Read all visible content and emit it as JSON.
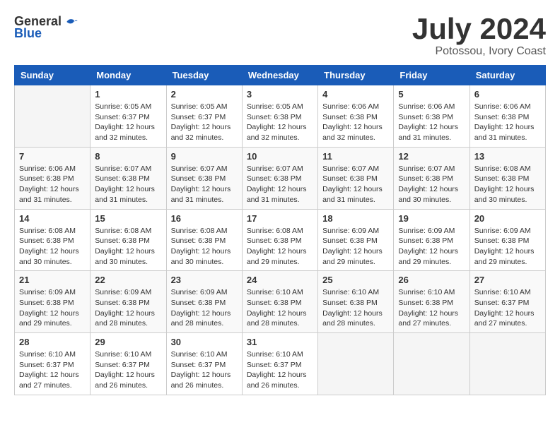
{
  "logo": {
    "general": "General",
    "blue": "Blue"
  },
  "title": {
    "month_year": "July 2024",
    "location": "Potossou, Ivory Coast"
  },
  "days_of_week": [
    "Sunday",
    "Monday",
    "Tuesday",
    "Wednesday",
    "Thursday",
    "Friday",
    "Saturday"
  ],
  "weeks": [
    [
      {
        "day": "",
        "info": ""
      },
      {
        "day": "1",
        "info": "Sunrise: 6:05 AM\nSunset: 6:37 PM\nDaylight: 12 hours\nand 32 minutes."
      },
      {
        "day": "2",
        "info": "Sunrise: 6:05 AM\nSunset: 6:37 PM\nDaylight: 12 hours\nand 32 minutes."
      },
      {
        "day": "3",
        "info": "Sunrise: 6:05 AM\nSunset: 6:38 PM\nDaylight: 12 hours\nand 32 minutes."
      },
      {
        "day": "4",
        "info": "Sunrise: 6:06 AM\nSunset: 6:38 PM\nDaylight: 12 hours\nand 32 minutes."
      },
      {
        "day": "5",
        "info": "Sunrise: 6:06 AM\nSunset: 6:38 PM\nDaylight: 12 hours\nand 31 minutes."
      },
      {
        "day": "6",
        "info": "Sunrise: 6:06 AM\nSunset: 6:38 PM\nDaylight: 12 hours\nand 31 minutes."
      }
    ],
    [
      {
        "day": "7",
        "info": "Sunrise: 6:06 AM\nSunset: 6:38 PM\nDaylight: 12 hours\nand 31 minutes."
      },
      {
        "day": "8",
        "info": "Sunrise: 6:07 AM\nSunset: 6:38 PM\nDaylight: 12 hours\nand 31 minutes."
      },
      {
        "day": "9",
        "info": "Sunrise: 6:07 AM\nSunset: 6:38 PM\nDaylight: 12 hours\nand 31 minutes."
      },
      {
        "day": "10",
        "info": "Sunrise: 6:07 AM\nSunset: 6:38 PM\nDaylight: 12 hours\nand 31 minutes."
      },
      {
        "day": "11",
        "info": "Sunrise: 6:07 AM\nSunset: 6:38 PM\nDaylight: 12 hours\nand 31 minutes."
      },
      {
        "day": "12",
        "info": "Sunrise: 6:07 AM\nSunset: 6:38 PM\nDaylight: 12 hours\nand 30 minutes."
      },
      {
        "day": "13",
        "info": "Sunrise: 6:08 AM\nSunset: 6:38 PM\nDaylight: 12 hours\nand 30 minutes."
      }
    ],
    [
      {
        "day": "14",
        "info": "Sunrise: 6:08 AM\nSunset: 6:38 PM\nDaylight: 12 hours\nand 30 minutes."
      },
      {
        "day": "15",
        "info": "Sunrise: 6:08 AM\nSunset: 6:38 PM\nDaylight: 12 hours\nand 30 minutes."
      },
      {
        "day": "16",
        "info": "Sunrise: 6:08 AM\nSunset: 6:38 PM\nDaylight: 12 hours\nand 30 minutes."
      },
      {
        "day": "17",
        "info": "Sunrise: 6:08 AM\nSunset: 6:38 PM\nDaylight: 12 hours\nand 29 minutes."
      },
      {
        "day": "18",
        "info": "Sunrise: 6:09 AM\nSunset: 6:38 PM\nDaylight: 12 hours\nand 29 minutes."
      },
      {
        "day": "19",
        "info": "Sunrise: 6:09 AM\nSunset: 6:38 PM\nDaylight: 12 hours\nand 29 minutes."
      },
      {
        "day": "20",
        "info": "Sunrise: 6:09 AM\nSunset: 6:38 PM\nDaylight: 12 hours\nand 29 minutes."
      }
    ],
    [
      {
        "day": "21",
        "info": "Sunrise: 6:09 AM\nSunset: 6:38 PM\nDaylight: 12 hours\nand 29 minutes."
      },
      {
        "day": "22",
        "info": "Sunrise: 6:09 AM\nSunset: 6:38 PM\nDaylight: 12 hours\nand 28 minutes."
      },
      {
        "day": "23",
        "info": "Sunrise: 6:09 AM\nSunset: 6:38 PM\nDaylight: 12 hours\nand 28 minutes."
      },
      {
        "day": "24",
        "info": "Sunrise: 6:10 AM\nSunset: 6:38 PM\nDaylight: 12 hours\nand 28 minutes."
      },
      {
        "day": "25",
        "info": "Sunrise: 6:10 AM\nSunset: 6:38 PM\nDaylight: 12 hours\nand 28 minutes."
      },
      {
        "day": "26",
        "info": "Sunrise: 6:10 AM\nSunset: 6:38 PM\nDaylight: 12 hours\nand 27 minutes."
      },
      {
        "day": "27",
        "info": "Sunrise: 6:10 AM\nSunset: 6:37 PM\nDaylight: 12 hours\nand 27 minutes."
      }
    ],
    [
      {
        "day": "28",
        "info": "Sunrise: 6:10 AM\nSunset: 6:37 PM\nDaylight: 12 hours\nand 27 minutes."
      },
      {
        "day": "29",
        "info": "Sunrise: 6:10 AM\nSunset: 6:37 PM\nDaylight: 12 hours\nand 26 minutes."
      },
      {
        "day": "30",
        "info": "Sunrise: 6:10 AM\nSunset: 6:37 PM\nDaylight: 12 hours\nand 26 minutes."
      },
      {
        "day": "31",
        "info": "Sunrise: 6:10 AM\nSunset: 6:37 PM\nDaylight: 12 hours\nand 26 minutes."
      },
      {
        "day": "",
        "info": ""
      },
      {
        "day": "",
        "info": ""
      },
      {
        "day": "",
        "info": ""
      }
    ]
  ]
}
